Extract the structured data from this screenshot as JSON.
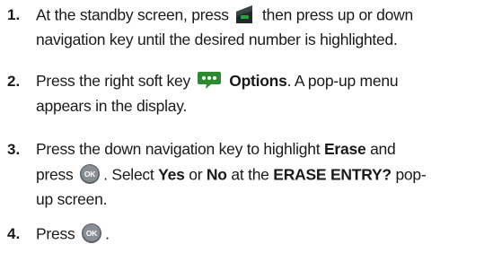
{
  "steps": [
    {
      "number": "1.",
      "line1_a": "At the standby screen, press",
      "line1_b": "then press up or down",
      "line2": "navigation key until the desired number is highlighted."
    },
    {
      "number": "2.",
      "line1_a": "Press the right soft key",
      "line1_bold": "Options",
      "line1_b": ". A pop-up menu",
      "line2": "appears in the display."
    },
    {
      "number": "3.",
      "line1_a": "Press the down navigation key to highlight",
      "line1_bold": "Erase",
      "line1_b": "and",
      "line2_a": "press",
      "line2_b": ". Select",
      "line2_yes": "Yes",
      "line2_or": "or",
      "line2_no": "No",
      "line2_c": "at the",
      "line2_erase_entry": "ERASE ENTRY?",
      "line2_d": "pop-",
      "line3": "up screen."
    },
    {
      "number": "4.",
      "line1_a": "Press",
      "line1_b": "."
    }
  ],
  "icons": {
    "send": "send-key-icon",
    "options": "options-soft-key-icon",
    "ok": "ok-button-icon"
  },
  "colors": {
    "send_key_body": "#1f2a2a",
    "send_key_highlight": "#2aa33a",
    "options_bubble": "#2d8a31",
    "ok_button_face": "#8a8f95"
  }
}
